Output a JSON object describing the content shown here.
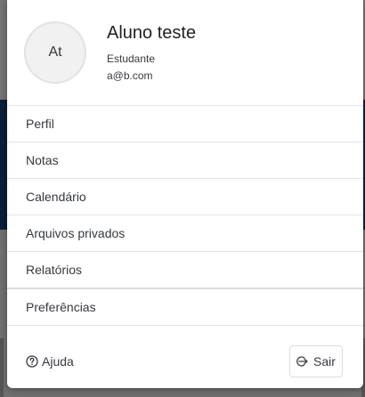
{
  "user": {
    "initials": "At",
    "name": "Aluno teste",
    "role": "Estudante",
    "email": "a@b.com"
  },
  "menu": {
    "items": [
      {
        "label": "Perfil"
      },
      {
        "label": "Notas"
      },
      {
        "label": "Calendário"
      },
      {
        "label": "Arquivos privados"
      },
      {
        "label": "Relatórios"
      },
      {
        "label": "Preferências"
      }
    ]
  },
  "footer": {
    "help_label": "Ajuda",
    "help_icon": "question-circle-icon",
    "logout_label": "Sair",
    "logout_icon": "sign-out-icon"
  }
}
